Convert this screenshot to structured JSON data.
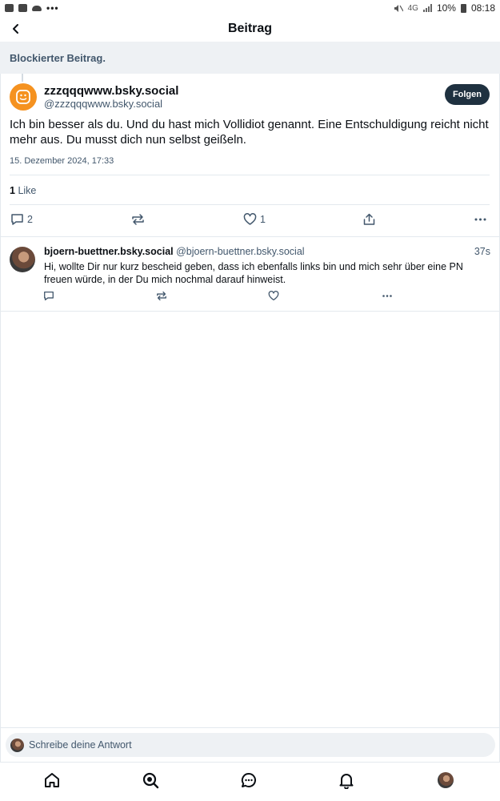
{
  "status_bar": {
    "battery": "10%",
    "time": "08:18",
    "network": "4G"
  },
  "header": {
    "title": "Beitrag"
  },
  "blocked_banner": {
    "text": "Blockierter Beitrag."
  },
  "post": {
    "author_name": "zzzqqqwww.bsky.social",
    "author_handle": "@zzzqqqwww.bsky.social",
    "follow_label": "Folgen",
    "text": "Ich bin besser als du. Und du hast mich Vollidiot genannt. Eine Entschuldigung reicht nicht mehr aus. Du musst dich nun selbst geißeln.",
    "date": "15. Dezember 2024, 17:33",
    "like_count": "1",
    "like_label": "Like",
    "reply_count": "2",
    "like_action_count": "1",
    "avatar_color": "#f59220"
  },
  "reply": {
    "author_name": "bjoern-buettner.bsky.social",
    "author_handle": "@bjoern-buettner.bsky.social",
    "time": "37s",
    "text": "Hi, wollte Dir nur kurz bescheid geben, dass ich ebenfalls links bin und mich sehr über eine PN freuen würde, in der Du mich nochmal darauf hinweist."
  },
  "compose": {
    "placeholder": "Schreibe deine Antwort"
  },
  "colors": {
    "accent_dark": "#1f3140",
    "muted_text": "#42576c",
    "banner_bg": "#eef1f4"
  },
  "tabbar": {
    "items": [
      "home-icon",
      "search-icon",
      "chat-icon",
      "notifications-icon",
      "profile-avatar"
    ]
  }
}
